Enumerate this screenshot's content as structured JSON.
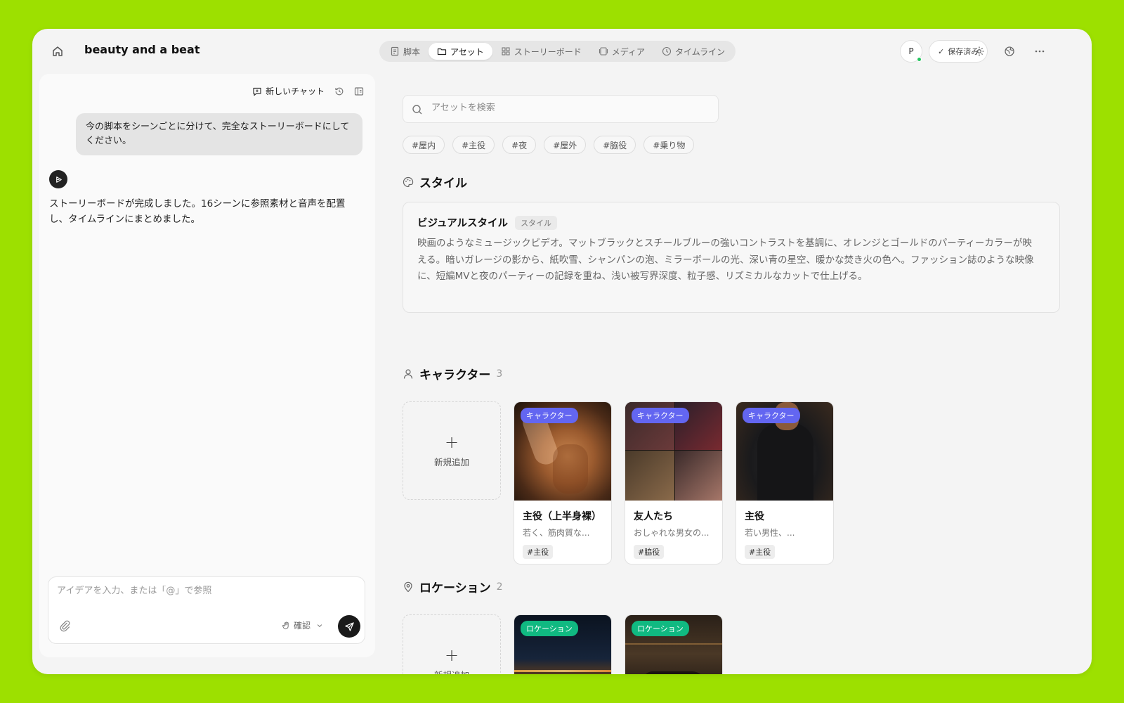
{
  "app": {
    "project_title": "beauty and a beat"
  },
  "tabs": [
    {
      "label": "脚本",
      "icon": "script-icon",
      "active": false
    },
    {
      "label": "アセット",
      "icon": "folder-icon",
      "active": true
    },
    {
      "label": "ストーリーボード",
      "icon": "grid-icon",
      "active": false
    },
    {
      "label": "メディア",
      "icon": "media-icon",
      "active": false
    },
    {
      "label": "タイムライン",
      "icon": "clock-icon",
      "active": false
    }
  ],
  "header": {
    "avatar_initial": "P",
    "saved_label": "保存済み"
  },
  "chat": {
    "new_chat_label": "新しいチャット",
    "user_message": "今の脚本をシーンごとに分けて、完全なストーリーボードにしてください。",
    "bot_message": "ストーリーボードが完成しました。16シーンに参照素材と音声を配置し、タイムラインにまとめました。",
    "input_placeholder": "アイデアを入力、または「@」で参照",
    "mode_label": "確認"
  },
  "assets": {
    "search_placeholder": "アセットを検索",
    "tags": [
      "#屋内",
      "#主役",
      "#夜",
      "#屋外",
      "#脇役",
      "#乗り物"
    ],
    "style_section": {
      "title": "スタイル",
      "card_name": "ビジュアルスタイル",
      "card_badge": "スタイル",
      "description": "映画のようなミュージックビデオ。マットブラックとスチールブルーの強いコントラストを基調に、オレンジとゴールドのパーティーカラーが映える。暗いガレージの影から、紙吹雪、シャンパンの泡、ミラーボールの光、深い青の星空、暖かな焚き火の色へ。ファッション誌のような映像に、短編MVと夜のパーティーの記録を重ね、浅い被写界深度、粒子感、リズミカルなカットで仕上げる。"
    },
    "character_section": {
      "title": "キャラクター",
      "count": "3",
      "add_label": "新規追加",
      "items": [
        {
          "badge": "キャラクター",
          "name": "主役（上半身裸）",
          "desc": "若く、筋肉質な...",
          "tag": "#主役"
        },
        {
          "badge": "キャラクター",
          "name": "友人たち",
          "desc": "おしゃれな男女の...",
          "tag": "#脇役"
        },
        {
          "badge": "キャラクター",
          "name": "主役",
          "desc": "若い男性、...",
          "tag": "#主役"
        }
      ]
    },
    "location_section": {
      "title": "ロケーション",
      "count": "2",
      "add_label": "新規追加",
      "items": [
        {
          "badge": "ロケーション"
        },
        {
          "badge": "ロケーション"
        }
      ]
    }
  },
  "colors": {
    "background": "#9de000",
    "character_badge": "#6366f1",
    "location_badge": "#10b981",
    "online_dot": "#22c55e"
  }
}
